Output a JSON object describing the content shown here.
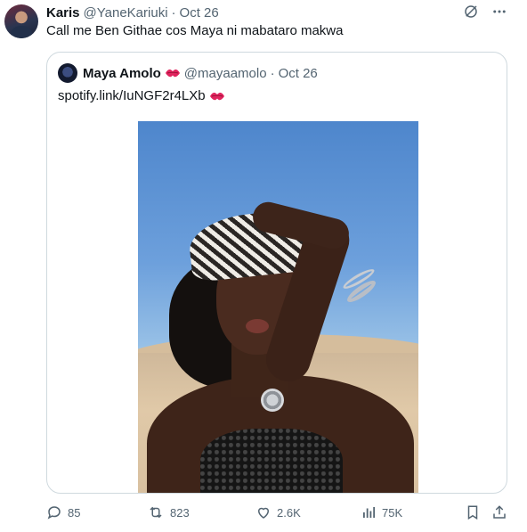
{
  "tweet": {
    "author_name": "Karis",
    "handle": "@YaneKariuki",
    "separator": "·",
    "date": "Oct 26",
    "text": "Call me Ben Githae cos Maya ni mabataro makwa"
  },
  "quoted_tweet": {
    "author_name": "Maya Amolo",
    "handle": "@mayaamolo",
    "separator": "·",
    "date": "Oct 26",
    "text": "spotify.link/IuNGF2r4LXb",
    "emoji_icon": "kiss-mark-icon"
  },
  "actions": {
    "replies": "85",
    "reposts": "823",
    "likes": "2.6K",
    "views": "75K"
  },
  "colors": {
    "text": "#0f1419",
    "secondary": "#536471",
    "border": "#cfd9de",
    "kiss_red": "#e0245e"
  }
}
